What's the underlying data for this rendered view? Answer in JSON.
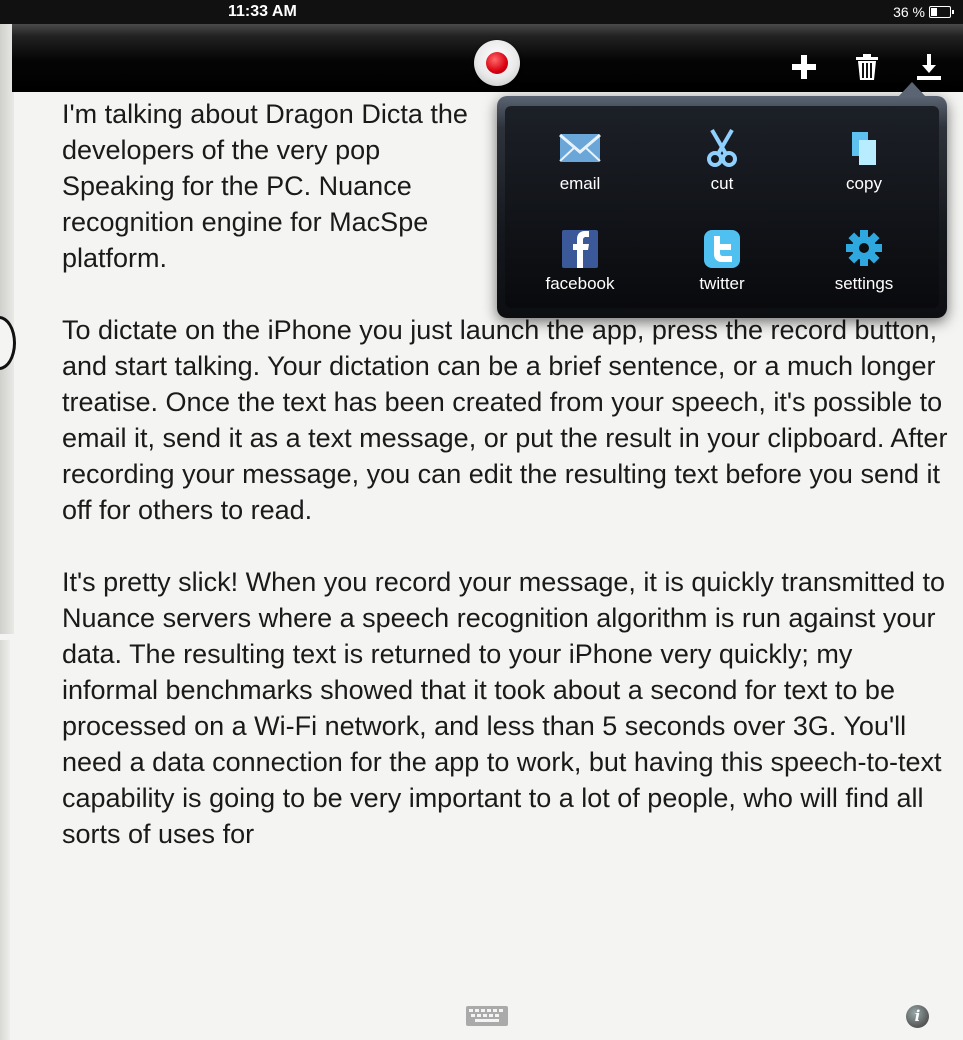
{
  "status_bar": {
    "time": "11:33 AM",
    "battery": "36 %"
  },
  "toolbar": {
    "record": "record-icon",
    "buttons": [
      "plus-icon",
      "trash-icon",
      "download-icon"
    ]
  },
  "share_menu": {
    "items": [
      {
        "label": "email",
        "icon": "envelope-icon"
      },
      {
        "label": "cut",
        "icon": "scissors-icon"
      },
      {
        "label": "copy",
        "icon": "copy-icon"
      },
      {
        "label": "facebook",
        "icon": "facebook-icon"
      },
      {
        "label": "twitter",
        "icon": "twitter-icon"
      },
      {
        "label": "settings",
        "icon": "gear-icon"
      }
    ]
  },
  "document": {
    "paragraphs": [
      "I'm talking about Dragon Dicta the developers of the very pop Speaking for the PC. Nuance recognition engine for MacSpe platform.",
      "To dictate on the iPhone you just launch the app, press the record button, and start talking. Your dictation can be a brief sentence, or a much longer treatise. Once the text has been created from your speech, it's possible to email it, send it as a text message, or put the result in your clipboard. After recording your message, you can edit the resulting text before you send it off for others to read.",
      "It's pretty slick! When you record your message, it is quickly transmitted to Nuance servers where a speech recognition algorithm is run against your data. The resulting text is returned to your iPhone very quickly; my informal benchmarks showed that it took about a second for text to be processed on a Wi-Fi network, and less than 5 seconds over 3G. You'll need a data connection for the app to work, but having this speech-to-text capability is going to be very important to a lot of people, who will find all sorts of uses for"
    ]
  },
  "bottom": {
    "keyboard": "keyboard-icon",
    "info": "i"
  }
}
